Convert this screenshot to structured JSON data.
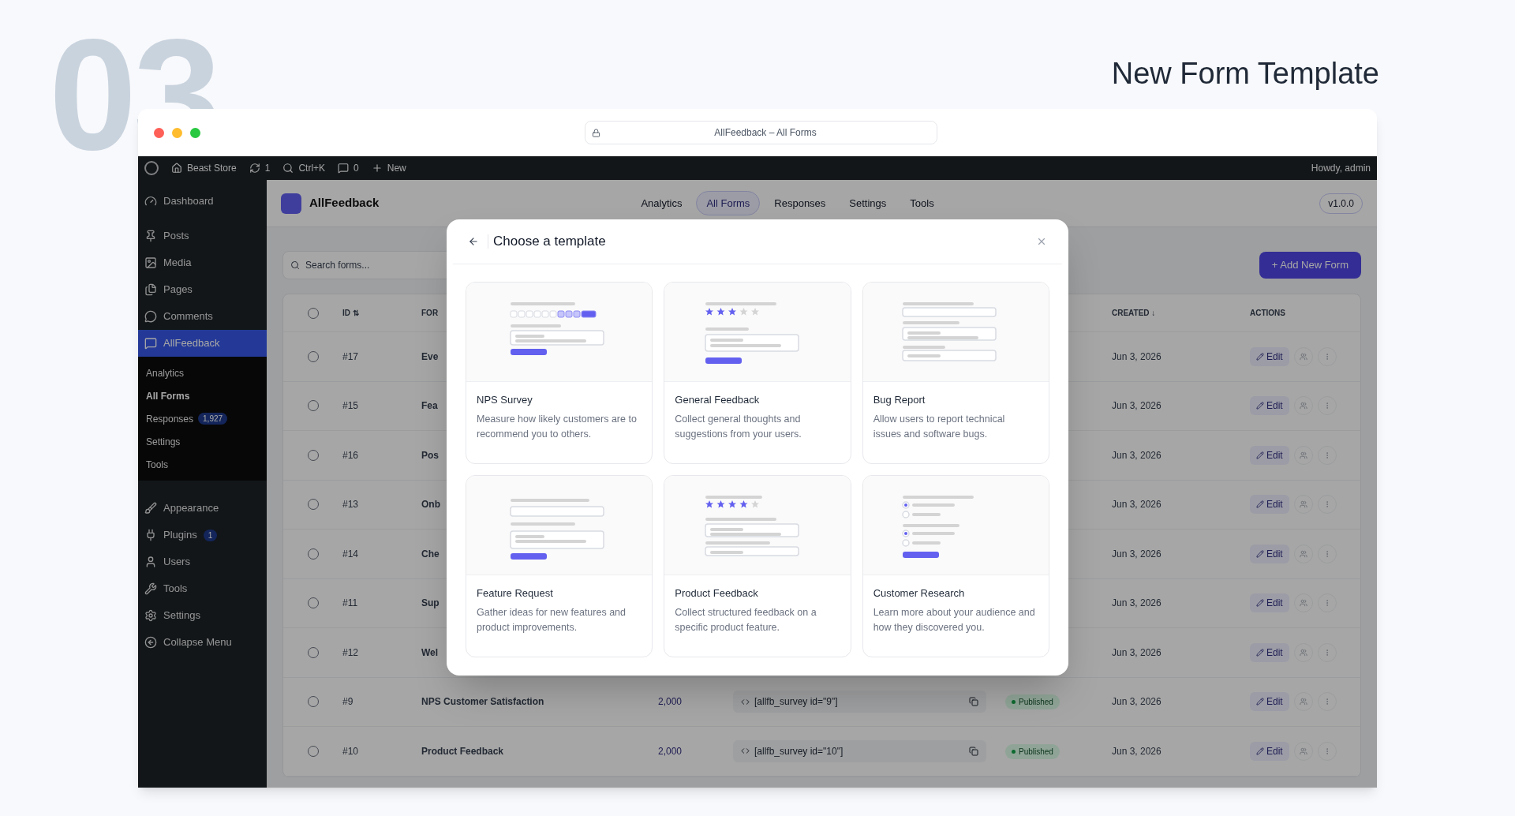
{
  "page": {
    "number": "03",
    "heading": "New Form Template"
  },
  "browser": {
    "url": "AllFeedback – All Forms"
  },
  "admin_bar": {
    "items": [
      {
        "kind": "home",
        "label": "Beast Store"
      },
      {
        "kind": "updates",
        "label": "1"
      },
      {
        "kind": "search",
        "label": "Ctrl+K"
      },
      {
        "kind": "comments",
        "label": "0"
      },
      {
        "kind": "new",
        "label": "New"
      }
    ],
    "greeting": "Howdy, admin"
  },
  "sidebar": {
    "items": [
      {
        "kind": "dashboard",
        "label": "Dashboard",
        "selected": false
      },
      {
        "kind": "pin",
        "label": "Posts",
        "selected": false
      },
      {
        "kind": "media",
        "label": "Media",
        "selected": false
      },
      {
        "kind": "pages",
        "label": "Pages",
        "selected": false
      },
      {
        "kind": "comments",
        "label": "Comments",
        "selected": false
      },
      {
        "kind": "feedback",
        "label": "AllFeedback",
        "selected": true,
        "children": [
          {
            "label": "Analytics",
            "selected": false
          },
          {
            "label": "All Forms",
            "selected": true
          },
          {
            "label": "Responses",
            "selected": false,
            "badge": "1,927"
          },
          {
            "label": "Settings",
            "selected": false
          },
          {
            "label": "Tools",
            "selected": false
          }
        ]
      },
      {
        "kind": "brush",
        "label": "Appearance",
        "selected": false
      },
      {
        "kind": "plug",
        "label": "Plugins",
        "selected": false,
        "badge": "1"
      },
      {
        "kind": "user",
        "label": "Users",
        "selected": false
      },
      {
        "kind": "wrench",
        "label": "Tools",
        "selected": false
      },
      {
        "kind": "settings",
        "label": "Settings",
        "selected": false
      },
      {
        "kind": "collapse",
        "label": "Collapse Menu",
        "selected": false
      }
    ]
  },
  "plugin_header": {
    "name": "AllFeedback",
    "tabs": [
      {
        "label": "Analytics",
        "selected": false
      },
      {
        "label": "All Forms",
        "selected": true
      },
      {
        "label": "Responses",
        "selected": false
      },
      {
        "label": "Settings",
        "selected": false
      },
      {
        "label": "Tools",
        "selected": false
      }
    ],
    "version": "v1.0.0"
  },
  "toolbar": {
    "search": {
      "placeholder": "Search forms..."
    },
    "add_button": "+ Add New Form"
  },
  "table": {
    "select_all": {
      "checked": false
    },
    "columns": [
      "ID ⇅",
      "FOR",
      "CREATED ↓",
      "ACTIONS"
    ],
    "rows": [
      {
        "id": "#17",
        "selected": false,
        "name": "Eve",
        "created": "Jun 3, 2026",
        "edit": "Edit"
      },
      {
        "id": "#15",
        "selected": false,
        "name": "Fea",
        "created": "Jun 3, 2026",
        "edit": "Edit"
      },
      {
        "id": "#16",
        "selected": false,
        "name": "Pos",
        "created": "Jun 3, 2026",
        "edit": "Edit"
      },
      {
        "id": "#13",
        "selected": false,
        "name": "Onb",
        "created": "Jun 3, 2026",
        "edit": "Edit"
      },
      {
        "id": "#14",
        "selected": false,
        "name": "Che",
        "created": "Jun 3, 2026",
        "edit": "Edit"
      },
      {
        "id": "#11",
        "selected": false,
        "name": "Sup",
        "created": "Jun 3, 2026",
        "edit": "Edit"
      },
      {
        "id": "#12",
        "selected": false,
        "name": "Wel",
        "created": "Jun 3, 2026",
        "edit": "Edit"
      },
      {
        "id": "#9",
        "selected": false,
        "name": "NPS Customer Satisfaction",
        "responses": "2,000",
        "shortcode": "[allfb_survey id=\"9\"]",
        "status": "Published",
        "created": "Jun 3, 2026",
        "edit": "Edit"
      },
      {
        "id": "#10",
        "selected": false,
        "name": "Product Feedback",
        "responses": "2,000",
        "shortcode": "[allfb_survey id=\"10\"]",
        "status": "Published",
        "created": "Jun 3, 2026",
        "edit": "Edit"
      }
    ]
  },
  "modal": {
    "title": "Choose a template",
    "templates": [
      {
        "kind": "nps",
        "title": "NPS Survey",
        "description": "Measure how likely customers are to recommend you to others."
      },
      {
        "kind": "rating",
        "title": "General Feedback",
        "description": "Collect general thoughts and suggestions from your users.",
        "stars": 3
      },
      {
        "kind": "bug",
        "title": "Bug Report",
        "description": "Allow users to report technical issues and software bugs."
      },
      {
        "kind": "feature",
        "title": "Feature Request",
        "description": "Gather ideas for new features and product improvements."
      },
      {
        "kind": "product",
        "title": "Product Feedback",
        "description": "Collect structured feedback on a specific product feature.",
        "stars": 4
      },
      {
        "kind": "research",
        "title": "Customer Research",
        "description": "Learn more about your audience and how they discovered you."
      }
    ]
  }
}
